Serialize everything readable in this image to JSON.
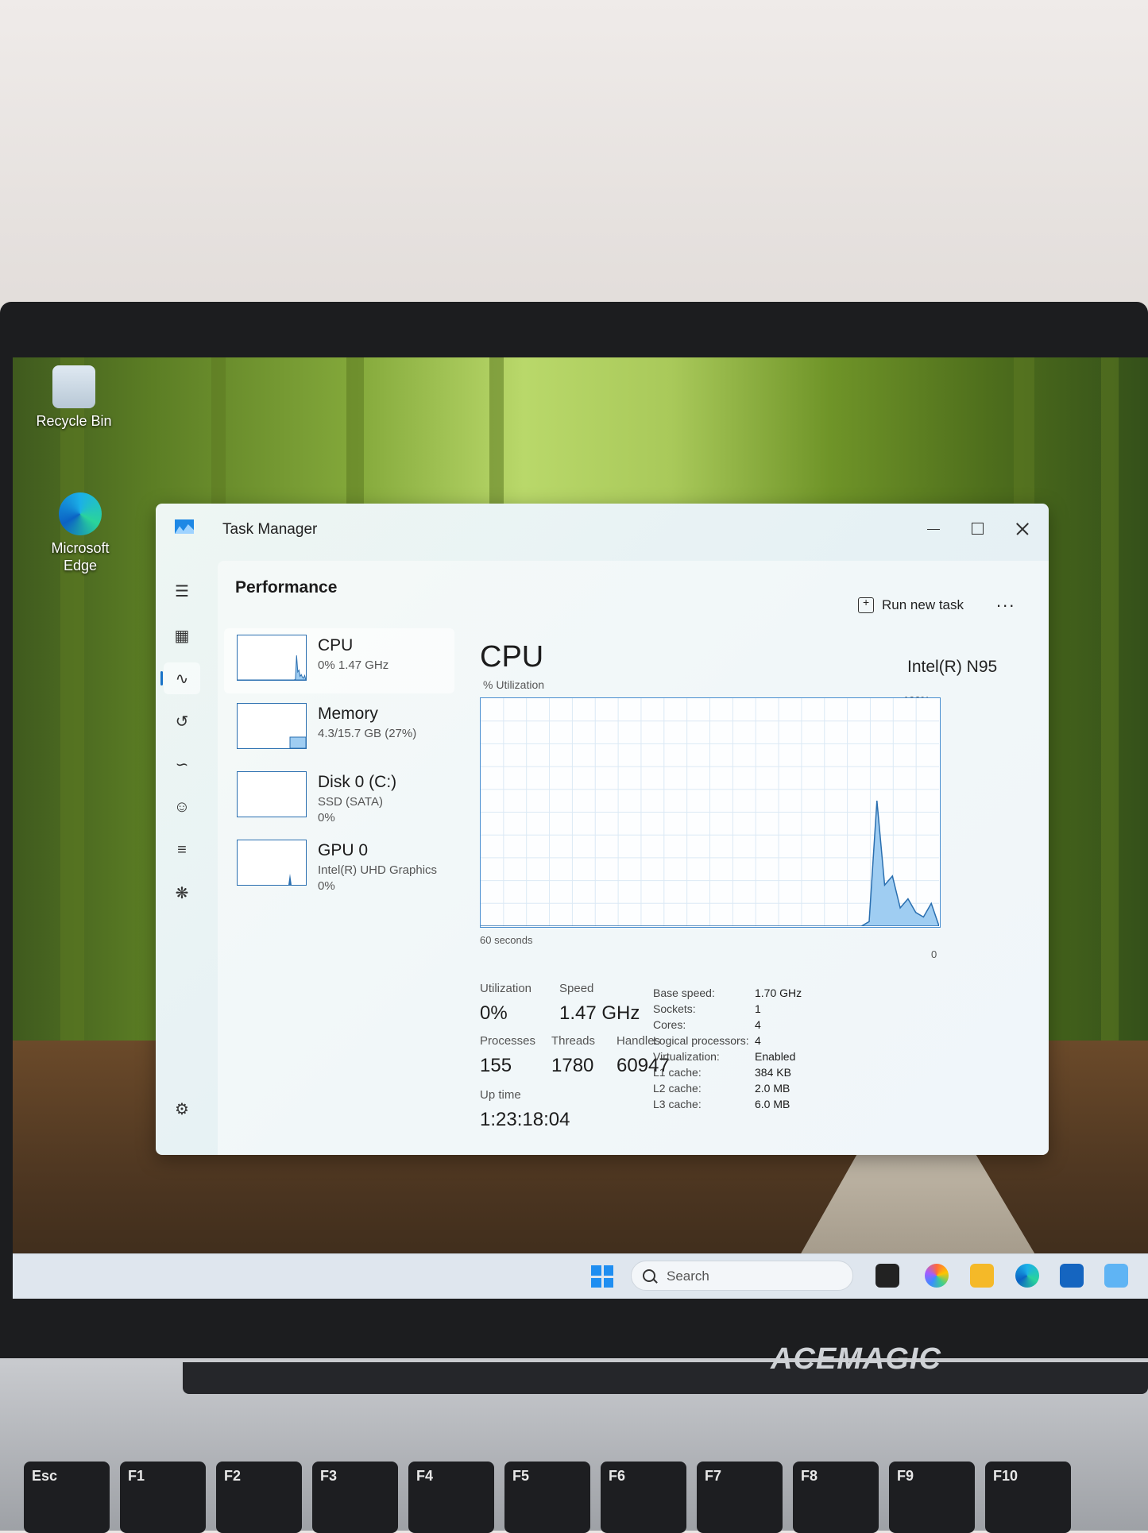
{
  "desktop": {
    "icons": [
      {
        "label_line1": "Recycle Bin",
        "label_line2": "",
        "icon": "recycle-bin-icon"
      },
      {
        "label_line1": "Microsoft",
        "label_line2": "Edge",
        "icon": "edge-icon"
      }
    ]
  },
  "window": {
    "title": "Task Manager",
    "section": "Performance",
    "run_new_task": "Run new task",
    "more": "..."
  },
  "nav": {
    "items": [
      "hamburger-menu-icon",
      "processes-icon",
      "performance-icon",
      "app-history-icon",
      "startup-apps-icon",
      "users-icon",
      "details-icon",
      "services-icon",
      "settings-icon"
    ],
    "active": "performance"
  },
  "perf_list": [
    {
      "name": "CPU",
      "sub": "0%  1.47 GHz",
      "sub2": ""
    },
    {
      "name": "Memory",
      "sub": "4.3/15.7 GB (27%)",
      "sub2": ""
    },
    {
      "name": "Disk 0 (C:)",
      "sub": "SSD (SATA)",
      "sub2": "0%"
    },
    {
      "name": "GPU 0",
      "sub": "Intel(R) UHD Graphics",
      "sub2": "0%"
    }
  ],
  "cpu": {
    "title": "CPU",
    "model": "Intel(R) N95",
    "util_label": "% Utilization",
    "max_label": "100%",
    "secs_label": "60 seconds",
    "zero_label": "0",
    "stats": {
      "utilization_label": "Utilization",
      "utilization": "0%",
      "speed_label": "Speed",
      "speed": "1.47 GHz",
      "processes_label": "Processes",
      "processes": "155",
      "threads_label": "Threads",
      "threads": "1780",
      "handles_label": "Handles",
      "handles": "60947",
      "uptime_label": "Up time",
      "uptime": "1:23:18:04"
    },
    "specs": [
      {
        "label": "Base speed:",
        "value": "1.70 GHz"
      },
      {
        "label": "Sockets:",
        "value": "1"
      },
      {
        "label": "Cores:",
        "value": "4"
      },
      {
        "label": "Logical processors:",
        "value": "4"
      },
      {
        "label": "Virtualization:",
        "value": "Enabled"
      },
      {
        "label": "L1 cache:",
        "value": "384 KB"
      },
      {
        "label": "L2 cache:",
        "value": "2.0 MB"
      },
      {
        "label": "L3 cache:",
        "value": "6.0 MB"
      }
    ],
    "history": [
      0,
      0,
      0,
      0,
      0,
      0,
      0,
      0,
      0,
      0,
      0,
      0,
      0,
      0,
      0,
      0,
      0,
      0,
      0,
      0,
      0,
      0,
      0,
      0,
      0,
      0,
      0,
      0,
      0,
      0,
      0,
      0,
      0,
      0,
      0,
      0,
      0,
      0,
      0,
      0,
      0,
      0,
      0,
      0,
      0,
      0,
      0,
      0,
      0,
      0,
      2,
      55,
      18,
      22,
      8,
      12,
      6,
      4,
      10,
      0
    ]
  },
  "taskbar": {
    "search_placeholder": "Search"
  },
  "laptop": {
    "brand": "ACEMAGIC",
    "keys": [
      "Esc",
      "F1",
      "F2",
      "F3",
      "F4",
      "F5",
      "F6",
      "F7",
      "F8",
      "F9",
      "F10"
    ]
  },
  "colors": {
    "accent": "#1a73c8",
    "graph_fill": "#9fcdf2",
    "graph_line": "#2a6fb0"
  }
}
